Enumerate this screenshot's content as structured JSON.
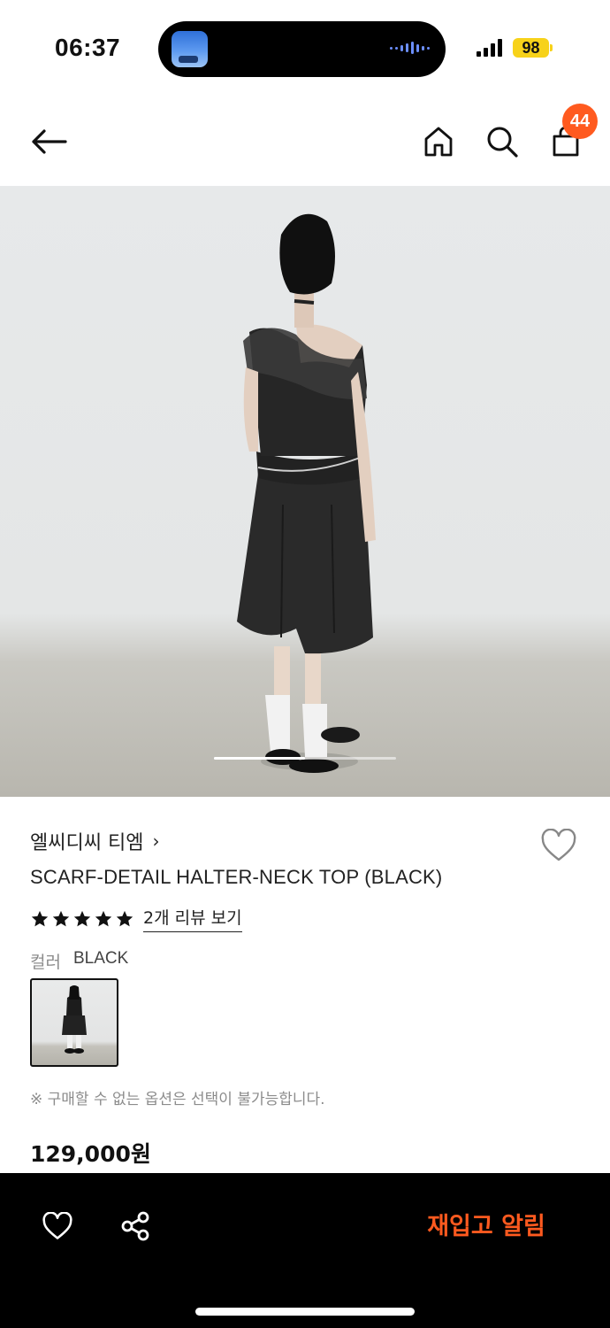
{
  "status_bar": {
    "time": "06:37",
    "battery": "98"
  },
  "nav": {
    "cart_count": "44"
  },
  "product": {
    "brand": "엘씨디씨 티엠",
    "brand_chevron": "›",
    "title": "SCARF-DETAIL HALTER-NECK TOP (BLACK)",
    "rating_stars": 5,
    "review_link": "2개 리뷰 보기",
    "color_label": "컬러",
    "color_value": "BLACK",
    "option_note": "※ 구매할 수 없는 옵션은 선택이 불가능합니다.",
    "price": "129,000원"
  },
  "bottom_bar": {
    "restock_label": "재입고 알림"
  },
  "colors": {
    "accent": "#ff5a1f",
    "battery": "#f7d21a",
    "bottom_bar_bg": "#000000"
  },
  "icons": [
    "back-arrow-icon",
    "home-icon",
    "search-icon",
    "shopping-bag-icon",
    "heart-icon",
    "share-icon",
    "star-icon"
  ]
}
